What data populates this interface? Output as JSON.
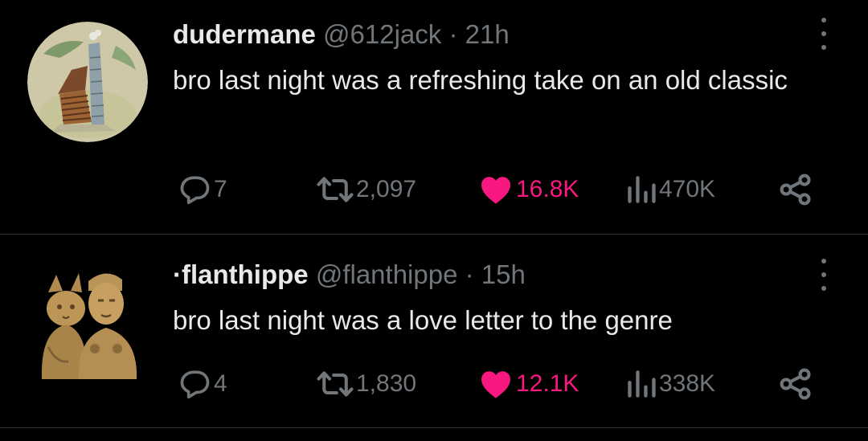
{
  "tweets": [
    {
      "display_name": "dudermane",
      "handle": "@612jack",
      "separator": "·",
      "time": "21h",
      "text": "bro last night was a refreshing take on an old classic",
      "avatar_icon": "log-cabin-icon",
      "stats": {
        "replies": "7",
        "retweets": "2,097",
        "likes": "16.8K",
        "views": "470K"
      }
    },
    {
      "display_name": "·flanthippe",
      "handle": "@flanthippe",
      "separator": "·",
      "time": "15h",
      "text": "bro last night was a love letter to the genre",
      "avatar_icon": "stone-statue-icon",
      "stats": {
        "replies": "4",
        "retweets": "1,830",
        "likes": "12.1K",
        "views": "338K"
      }
    }
  ],
  "colors": {
    "background": "#000000",
    "text_primary": "#e7e9ea",
    "text_secondary": "#71767b",
    "like_pink": "#f91880",
    "divider": "#2f3336"
  },
  "icons": [
    "reply-icon",
    "retweet-icon",
    "heart-icon",
    "views-icon",
    "share-icon",
    "more-options-icon"
  ]
}
